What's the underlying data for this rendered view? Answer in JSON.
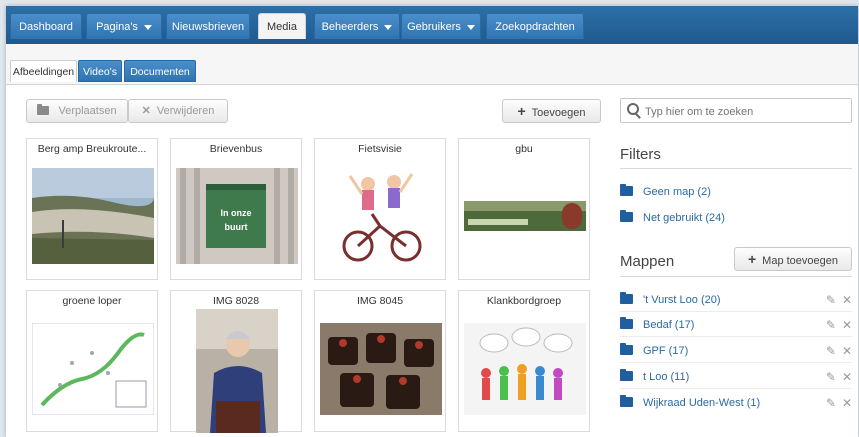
{
  "nav": {
    "tabs": [
      {
        "label": "Dashboard"
      },
      {
        "label": "Pagina's"
      },
      {
        "label": "Nieuwsbrieven"
      },
      {
        "label": "Media"
      },
      {
        "label": "Beheerders"
      },
      {
        "label": "Gebruikers"
      },
      {
        "label": "Zoekopdrachten"
      }
    ]
  },
  "subtabs": [
    {
      "label": "Afbeeldingen"
    },
    {
      "label": "Video's"
    },
    {
      "label": "Documenten"
    }
  ],
  "toolbar": {
    "move_label": "Verplaatsen",
    "delete_label": "Verwijderen",
    "add_label": "Toevoegen",
    "search_placeholder": "Typ hier om te zoeken"
  },
  "images": [
    {
      "title": "Berg amp Breukroute..."
    },
    {
      "title": "Brievenbus",
      "sign_text_1": "In onze",
      "sign_text_2": "buurt"
    },
    {
      "title": "Fietsvisie"
    },
    {
      "title": "gbu"
    },
    {
      "title": "groene loper"
    },
    {
      "title": "IMG 8028"
    },
    {
      "title": "IMG 8045"
    },
    {
      "title": "Klankbordgroep"
    }
  ],
  "filters": {
    "title": "Filters",
    "items": [
      {
        "label": "Geen map (2)"
      },
      {
        "label": "Net gebruikt (24)"
      }
    ]
  },
  "folders": {
    "title": "Mappen",
    "add_label": "Map toevoegen",
    "items": [
      {
        "label": "'t Vurst Loo (20)"
      },
      {
        "label": "Bedaf (17)"
      },
      {
        "label": "GPF (17)"
      },
      {
        "label": "t Loo (11)"
      },
      {
        "label": "Wijkraad Uden-West (1)"
      }
    ]
  },
  "colors": {
    "nav_blue": "#2f73b0",
    "link_blue": "#2a6aa2",
    "folder_blue": "#1f5f9f"
  }
}
